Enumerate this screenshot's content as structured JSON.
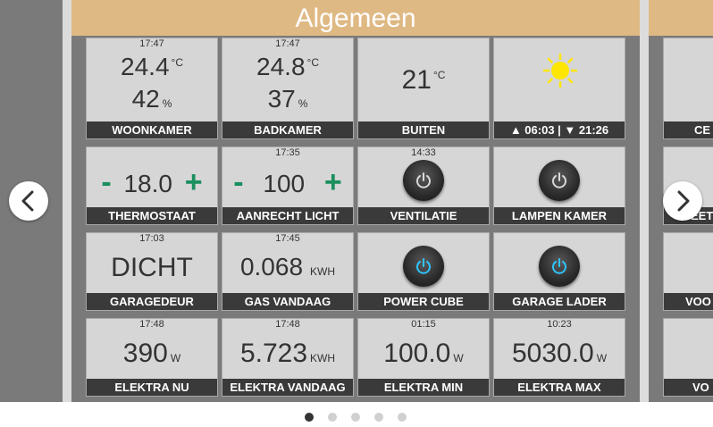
{
  "header": {
    "title": "Algemeen"
  },
  "tiles": {
    "woonkamer": {
      "time": "17:47",
      "temp": "24.4",
      "temp_unit": "°C",
      "humidity": "42",
      "humidity_unit": "%",
      "label": "WOONKAMER"
    },
    "badkamer": {
      "time": "17:47",
      "temp": "24.8",
      "temp_unit": "°C",
      "humidity": "37",
      "humidity_unit": "%",
      "label": "BADKAMER"
    },
    "buiten": {
      "temp": "21",
      "temp_unit": "°C",
      "label": "BUITEN"
    },
    "sun": {
      "label": "▲ 06:03 | ▼ 21:26",
      "icon": "sun-icon",
      "color": "#ffe600"
    },
    "thermostaat": {
      "minus": "-",
      "value": "18.0",
      "plus": "+",
      "label": "THERMOSTAAT"
    },
    "aanrecht": {
      "time": "17:35",
      "minus": "-",
      "value": "100",
      "plus": "+",
      "label": "AANRECHT LICHT"
    },
    "ventilatie": {
      "time": "14:33",
      "state": "off",
      "label": "VENTILATIE"
    },
    "lampen": {
      "state": "off",
      "label": "LAMPEN KAMER"
    },
    "garagedeur": {
      "time": "17:03",
      "value": "DICHT",
      "label": "GARAGEDEUR"
    },
    "gas": {
      "time": "17:45",
      "value": "0.068",
      "unit": "KWH",
      "label": "GAS VANDAAG"
    },
    "powercube": {
      "state": "on",
      "label": "POWER CUBE"
    },
    "garagelader": {
      "state": "on",
      "label": "GARAGE LADER"
    },
    "elektra_nu": {
      "time": "17:48",
      "value": "390",
      "unit": "W",
      "label": "ELEKTRA NU"
    },
    "elektra_vandaag": {
      "time": "17:48",
      "value": "5.723",
      "unit": "KWH",
      "label": "ELEKTRA VANDAAG"
    },
    "elektra_min": {
      "time": "01:15",
      "value": "100.0",
      "unit": "W",
      "label": "ELEKTRA MIN"
    },
    "elektra_max": {
      "time": "10:23",
      "value": "5030.0",
      "unit": "W",
      "label": "ELEKTRA MAX"
    }
  },
  "right_panel": {
    "labels": [
      "CE",
      "EET",
      "VOO",
      "VO"
    ]
  },
  "colors": {
    "accent_green": "#1b8f5e",
    "power_on": "#2ec4ff",
    "power_off": "#d8d8d8",
    "header": "#dfb984"
  },
  "pagination": {
    "pages": 5,
    "active": 1
  }
}
